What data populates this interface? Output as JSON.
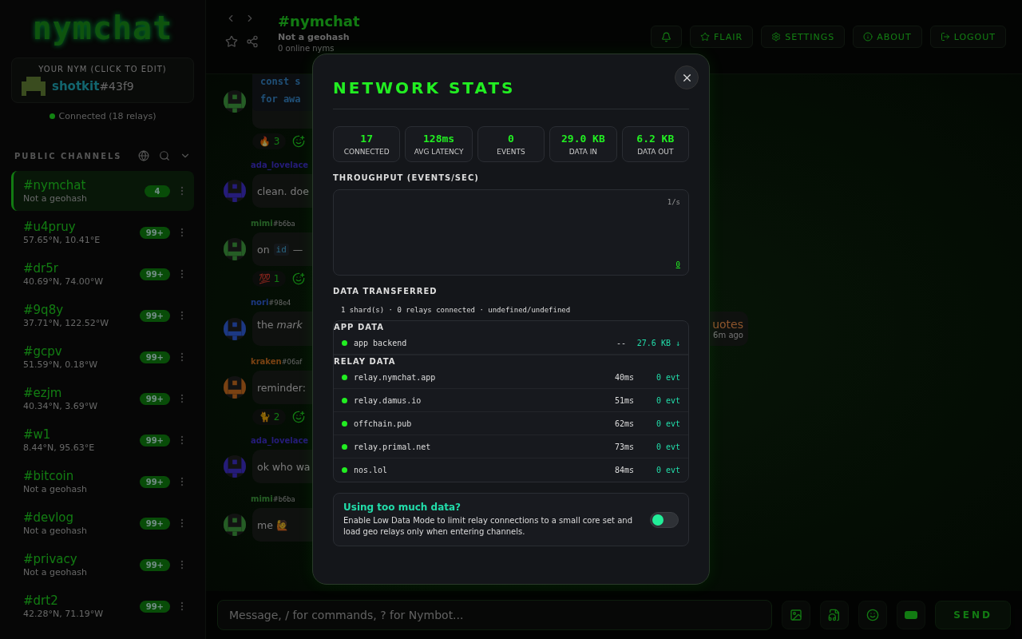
{
  "sidebar": {
    "logo": "nymchat",
    "nym_card": {
      "caption": "YOUR NYM (CLICK TO EDIT)",
      "name": "shotkit",
      "suffix": "#43f9"
    },
    "connection": {
      "status": "Connected (18 relays)",
      "connected": true
    },
    "section_title": "PUBLIC CHANNELS",
    "channels": [
      {
        "name": "#nymchat",
        "subtitle": "Not a geohash",
        "badge": "4",
        "selected": true
      },
      {
        "name": "#u4pruy",
        "subtitle": "57.65°N, 10.41°E",
        "badge": "99+",
        "selected": false
      },
      {
        "name": "#dr5r",
        "subtitle": "40.69°N, 74.00°W",
        "badge": "99+",
        "selected": false
      },
      {
        "name": "#9q8y",
        "subtitle": "37.71°N, 122.52°W",
        "badge": "99+",
        "selected": false
      },
      {
        "name": "#gcpv",
        "subtitle": "51.59°N, 0.18°W",
        "badge": "99+",
        "selected": false
      },
      {
        "name": "#ezjm",
        "subtitle": "40.34°N, 3.69°W",
        "badge": "99+",
        "selected": false
      },
      {
        "name": "#w1",
        "subtitle": "8.44°N, 95.63°E",
        "badge": "99+",
        "selected": false
      },
      {
        "name": "#bitcoin",
        "subtitle": "Not a geohash",
        "badge": "99+",
        "selected": false
      },
      {
        "name": "#devlog",
        "subtitle": "Not a geohash",
        "badge": "99+",
        "selected": false
      },
      {
        "name": "#privacy",
        "subtitle": "Not a geohash",
        "badge": "99+",
        "selected": false
      },
      {
        "name": "#drt2",
        "subtitle": "42.28°N, 71.19°W",
        "badge": "99+",
        "selected": false
      }
    ]
  },
  "header": {
    "title": "#nymchat",
    "subtitle": "Not a geohash",
    "online": "0 online nyms",
    "buttons": [
      "FLAIR",
      "SETTINGS",
      "ABOUT",
      "LOGOUT"
    ]
  },
  "messages": [
    {
      "kind": "code",
      "lines": [
        "const s",
        "for awa"
      ],
      "reactions": [
        {
          "emoji": "🔥",
          "count": "3"
        }
      ]
    },
    {
      "kind": "text",
      "author": "ada_lovelace",
      "parts": [
        {
          "kind": "text",
          "text": "clean. doe"
        }
      ]
    },
    {
      "kind": "text",
      "author": "mimi",
      "tag": "#b6ba",
      "parts": [
        {
          "kind": "text",
          "text": "on"
        },
        {
          "kind": "code",
          "text": "id"
        },
        {
          "kind": "text",
          "text": "—"
        }
      ],
      "reactions": [
        {
          "emoji": "💯",
          "count": "1"
        }
      ]
    },
    {
      "kind": "text",
      "author": "nori",
      "tag": "#98e4",
      "parts": [
        {
          "kind": "text",
          "text": "the *mark*"
        }
      ],
      "end_text": "uotes",
      "time": "6m ago"
    },
    {
      "kind": "text",
      "author": "kraken",
      "tag": "#06af",
      "parts": [
        {
          "kind": "text",
          "text": "reminder:"
        }
      ],
      "reactions": [
        {
          "emoji": "🐈",
          "count": "2"
        }
      ]
    },
    {
      "kind": "text",
      "author": "ada_lovelace",
      "parts": [
        {
          "kind": "text",
          "text": "ok who wa"
        }
      ]
    },
    {
      "kind": "text",
      "author": "mimi",
      "tag": "#b6ba",
      "parts": [
        {
          "kind": "text",
          "text": "me 🙋"
        }
      ]
    }
  ],
  "composer": {
    "placeholder": "Message, / for commands, ? for Nymbot...",
    "send": "SEND"
  },
  "modal": {
    "title": "NETWORK STATS",
    "stats": [
      {
        "value": "17",
        "label": "CONNECTED"
      },
      {
        "value": "128ms",
        "label": "AVG LATENCY"
      },
      {
        "value": "0",
        "label": "EVENTS"
      },
      {
        "value": "29.0 KB",
        "label": "DATA IN"
      },
      {
        "value": "6.2 KB",
        "label": "DATA OUT"
      }
    ],
    "throughput": {
      "title": "THROUGHPUT (EVENTS/SEC)",
      "max_label": "1/s",
      "min_label": "0"
    },
    "transfer": {
      "title": "DATA TRANSFERRED",
      "summary": "1 shard(s) · 0 relays connected · undefined/undefined",
      "app_title": "APP DATA",
      "app_rows": [
        {
          "name": "app backend",
          "connected": true,
          "latency": "--",
          "amount": "27.6 KB ↓"
        }
      ],
      "relay_title": "RELAY DATA",
      "relay_rows": [
        {
          "name": "relay.nymchat.app",
          "connected": true,
          "latency": "40ms",
          "amount": "0 evt"
        },
        {
          "name": "relay.damus.io",
          "connected": true,
          "latency": "51ms",
          "amount": "0 evt"
        },
        {
          "name": "offchain.pub",
          "connected": true,
          "latency": "62ms",
          "amount": "0 evt"
        },
        {
          "name": "relay.primal.net",
          "connected": true,
          "latency": "73ms",
          "amount": "0 evt"
        },
        {
          "name": "nos.lol",
          "connected": true,
          "latency": "84ms",
          "amount": "0 evt"
        }
      ]
    },
    "low_data": {
      "title": "Using too much data?",
      "description": "Enable Low Data Mode to limit relay connections to a small core set and load geo relays only when entering channels.",
      "on": false
    }
  }
}
